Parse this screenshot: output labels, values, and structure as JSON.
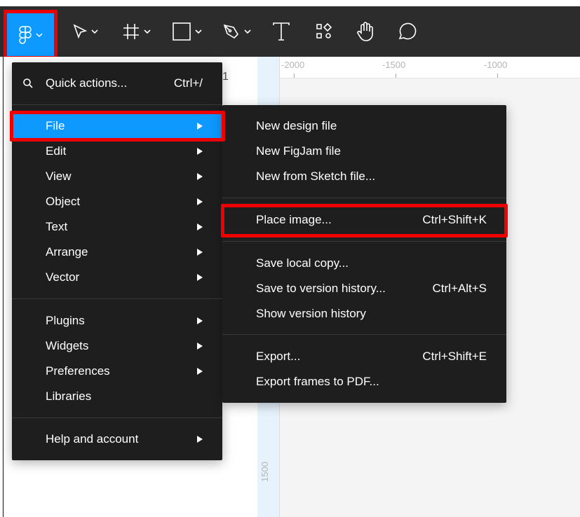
{
  "toolbar": {
    "tools": [
      "figma-menu",
      "move",
      "frame",
      "shape",
      "pen",
      "text",
      "resources",
      "hand",
      "comment"
    ]
  },
  "rulers": {
    "h": [
      "-2000",
      "-1500",
      "-1000"
    ],
    "v": [
      "1500"
    ]
  },
  "panel": {
    "partial_text": "1"
  },
  "main_menu": {
    "quick_actions": {
      "label": "Quick actions...",
      "shortcut": "Ctrl+/"
    },
    "items": [
      {
        "label": "File"
      },
      {
        "label": "Edit"
      },
      {
        "label": "View"
      },
      {
        "label": "Object"
      },
      {
        "label": "Text"
      },
      {
        "label": "Arrange"
      },
      {
        "label": "Vector"
      }
    ],
    "items2": [
      {
        "label": "Plugins"
      },
      {
        "label": "Widgets"
      },
      {
        "label": "Preferences"
      },
      {
        "label": "Libraries"
      }
    ],
    "help": {
      "label": "Help and account"
    }
  },
  "file_menu": {
    "group1": [
      {
        "label": "New design file"
      },
      {
        "label": "New FigJam file"
      },
      {
        "label": "New from Sketch file..."
      }
    ],
    "place": {
      "label": "Place image...",
      "shortcut": "Ctrl+Shift+K"
    },
    "group3": [
      {
        "label": "Save local copy...",
        "shortcut": ""
      },
      {
        "label": "Save to version history...",
        "shortcut": "Ctrl+Alt+S"
      },
      {
        "label": "Show version history",
        "shortcut": ""
      }
    ],
    "group4": [
      {
        "label": "Export...",
        "shortcut": "Ctrl+Shift+E"
      },
      {
        "label": "Export frames to PDF...",
        "shortcut": ""
      }
    ]
  }
}
